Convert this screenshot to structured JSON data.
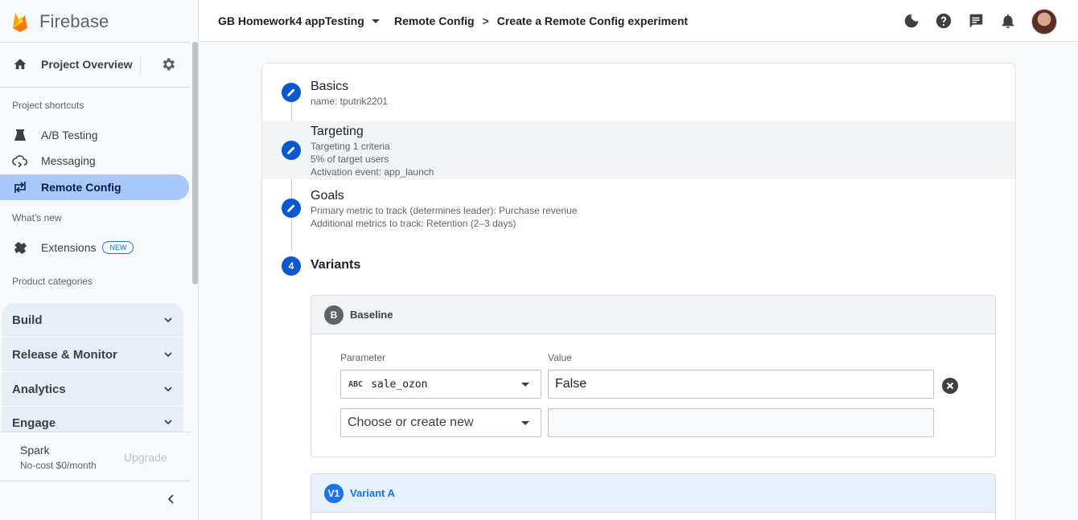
{
  "app": {
    "name": "Firebase"
  },
  "sidebar": {
    "overview_label": "Project Overview",
    "shortcuts_heading": "Project shortcuts",
    "shortcuts": [
      {
        "label": "A/B Testing",
        "icon": "flask-icon"
      },
      {
        "label": "Messaging",
        "icon": "cloud-message-icon"
      },
      {
        "label": "Remote Config",
        "icon": "remote-config-icon",
        "active": true
      }
    ],
    "whats_new_heading": "What's new",
    "extensions_label": "Extensions",
    "extensions_badge": "NEW",
    "categories_heading": "Product categories",
    "categories": [
      "Build",
      "Release & Monitor",
      "Analytics",
      "Engage"
    ],
    "plan": {
      "name": "Spark",
      "price": "No-cost $0/month",
      "upgrade_label": "Upgrade"
    }
  },
  "header": {
    "project": "GB Homework4 appTesting",
    "breadcrumb": [
      "Remote Config",
      "Create a Remote Config experiment"
    ],
    "icons": [
      "dark-mode-icon",
      "help-icon",
      "feedback-icon",
      "notifications-icon",
      "avatar"
    ]
  },
  "steps": [
    {
      "title": "Basics",
      "details": [
        "name: tputrik2201"
      ]
    },
    {
      "title": "Targeting",
      "details": [
        "Targeting 1 criteria",
        "5% of target users",
        "Activation event: app_launch"
      ]
    },
    {
      "title": "Goals",
      "details": [
        "Primary metric to track (determines leader): Purchase revenue",
        "Additional metrics to track: Retention (2–3 days)"
      ]
    },
    {
      "number": "4",
      "title": "Variants"
    }
  ],
  "variants": {
    "baseline": {
      "badge": "B",
      "name": "Baseline",
      "parameter_label": "Parameter",
      "value_label": "Value",
      "type_icon": "ABC",
      "parameter": "sale_ozon",
      "value": "False",
      "new_parameter_placeholder": "Choose or create new"
    },
    "variant_a": {
      "badge": "V1",
      "name": "Variant A"
    }
  },
  "colors": {
    "primary": "#0b57d0",
    "active_nav": "#a8c7fa",
    "variant_a_head": "#e8f0fe",
    "firebase_orange": "#ffa000"
  }
}
